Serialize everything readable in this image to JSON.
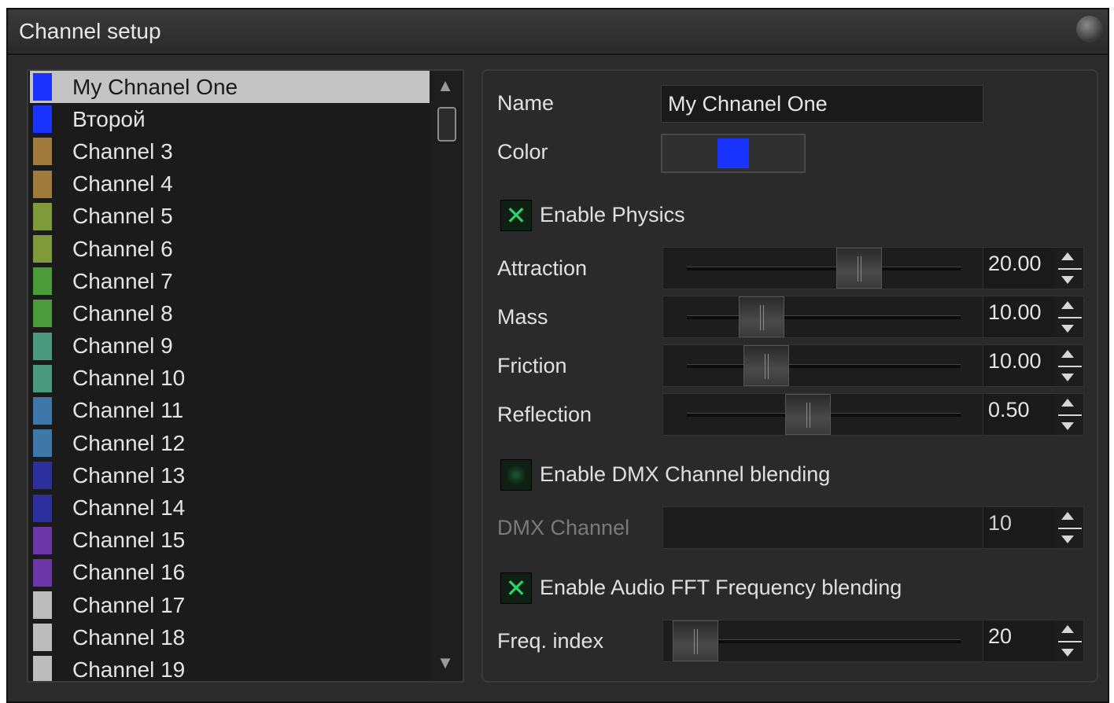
{
  "window": {
    "title": "Channel setup"
  },
  "channels": [
    {
      "label": "My Chnanel One",
      "color": "#1a33ff",
      "selected": true
    },
    {
      "label": "Второй",
      "color": "#1a33ff"
    },
    {
      "label": "Channel 3",
      "color": "#a07a3a"
    },
    {
      "label": "Channel 4",
      "color": "#a07a3a"
    },
    {
      "label": "Channel 5",
      "color": "#7f9a3a"
    },
    {
      "label": "Channel 6",
      "color": "#7f9a3a"
    },
    {
      "label": "Channel 7",
      "color": "#4b9b3a"
    },
    {
      "label": "Channel 8",
      "color": "#4b9b3a"
    },
    {
      "label": "Channel 9",
      "color": "#4a9a80"
    },
    {
      "label": "Channel 10",
      "color": "#4a9a80"
    },
    {
      "label": "Channel 11",
      "color": "#3e78a8"
    },
    {
      "label": "Channel 12",
      "color": "#3e78a8"
    },
    {
      "label": "Channel 13",
      "color": "#2d2f9e"
    },
    {
      "label": "Channel 14",
      "color": "#2d2f9e"
    },
    {
      "label": "Channel 15",
      "color": "#6a36a8"
    },
    {
      "label": "Channel 16",
      "color": "#6a36a8"
    },
    {
      "label": "Channel 17",
      "color": "#bcbcbc"
    },
    {
      "label": "Channel 18",
      "color": "#bcbcbc"
    },
    {
      "label": "Channel 19",
      "color": "#bcbcbc"
    }
  ],
  "scrollbar": {
    "up_icon": "▲",
    "down_icon": "▼"
  },
  "props": {
    "name_label": "Name",
    "name_value": "My Chnanel One",
    "color_label": "Color",
    "color_value": "#1a33ff",
    "physics": {
      "enable_label": "Enable Physics",
      "enabled": true,
      "sliders": [
        {
          "label": "Attraction",
          "value": "20.00",
          "fraction": 0.67
        },
        {
          "label": "Mass",
          "value": "10.00",
          "fraction": 0.27
        },
        {
          "label": "Friction",
          "value": "10.00",
          "fraction": 0.29
        },
        {
          "label": "Reflection",
          "value": "0.50",
          "fraction": 0.46
        }
      ]
    },
    "dmx": {
      "enable_label": "Enable DMX Channel blending",
      "enabled": false,
      "channel_label": "DMX Channel",
      "channel_value": "10"
    },
    "audio": {
      "enable_label": "Enable Audio FFT Frequency blending",
      "enabled": true,
      "freq_label": "Freq. index",
      "freq_value": "20",
      "fraction": 0.0
    }
  }
}
